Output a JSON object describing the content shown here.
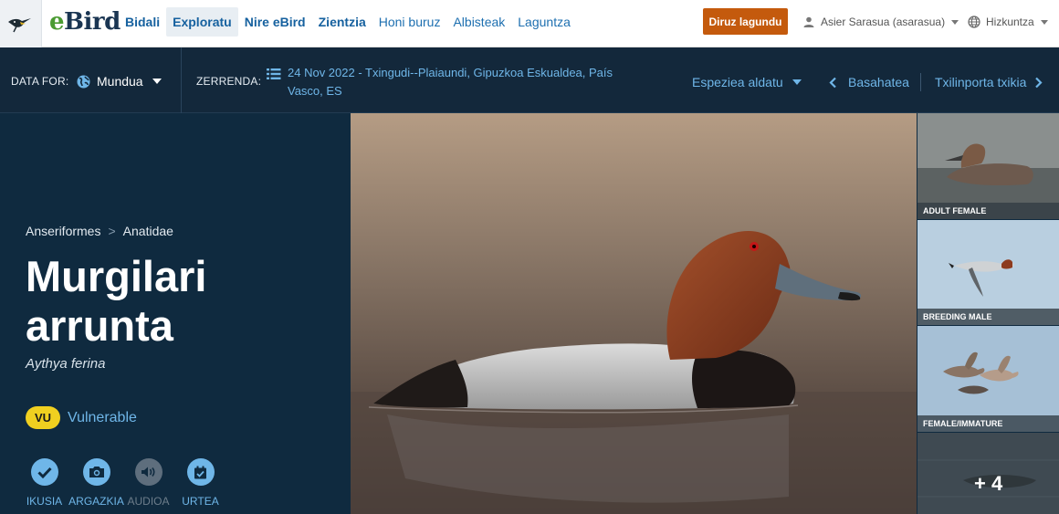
{
  "header": {
    "logo_e": "e",
    "logo_bird": "Bird",
    "nav": [
      {
        "label": "Bidali",
        "strong": true
      },
      {
        "label": "Exploratu",
        "strong": true
      },
      {
        "label": "Nire eBird",
        "strong": true
      },
      {
        "label": "Zientzia",
        "strong": true
      },
      {
        "label": "Honi buruz"
      },
      {
        "label": "Albisteak"
      },
      {
        "label": "Laguntza"
      }
    ],
    "donate_label": "Diruz lagundu",
    "user_label": "Asier Sarasua (asarasua)",
    "language_label": "Hizkuntza"
  },
  "filter_bar": {
    "data_for_label": "DATA FOR:",
    "region_value": "Mundua",
    "checklist_label": "ZERRENDA:",
    "checklist_value": "24 Nov 2022 - Txingudi--Plaiaundi, Gipuzkoa Eskualdea, País Vasco, ES",
    "change_species_label": "Espeziea aldatu",
    "previous_label": "Basahatea",
    "next_label": "Txilinporta txikia"
  },
  "species": {
    "order": "Anseriformes",
    "separator": ">",
    "family": "Anatidae",
    "common_name": "Murgilari arrunta",
    "scientific_name": "Aythya ferina",
    "status_code": "VU",
    "status_label": "Vulnerable",
    "status_color": "#f0d020",
    "media": [
      {
        "label": "IKUSIA",
        "icon": "checkmark-icon",
        "enabled": true
      },
      {
        "label": "ARGAZKIA",
        "icon": "camera-icon",
        "enabled": true
      },
      {
        "label": "AUDIOA",
        "icon": "speaker-icon",
        "enabled": false
      },
      {
        "label": "URTEA",
        "icon": "calendar-check-icon",
        "enabled": true
      }
    ]
  },
  "thumbnails": [
    {
      "caption": "ADULT FEMALE"
    },
    {
      "caption": "BREEDING MALE"
    },
    {
      "caption": "FEMALE/IMMATURE"
    },
    {
      "more_label": "+ 4"
    }
  ],
  "colors": {
    "accent_blue": "#6fb6e8",
    "dark_navy": "#0f2a3f",
    "donate_orange": "#c45a0d",
    "logo_green": "#4a9b32"
  }
}
